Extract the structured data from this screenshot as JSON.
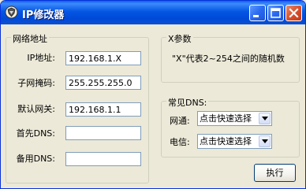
{
  "window": {
    "title": "IP修改器",
    "controls": [
      "minimize-icon",
      "maximize-icon",
      "close-icon"
    ],
    "titlebar_color": "#0054E3",
    "face_color": "#ECE9D8"
  },
  "network": {
    "group_title": "网络地址",
    "ip_label": "IP地址:",
    "ip_value": "192.168.1.X",
    "mask_label": "子网掩码:",
    "mask_value": "255.255.255.0",
    "gateway_label": "默认网关:",
    "gateway_value": "192.168.1.1",
    "dns1_label": "首先DNS:",
    "dns1_value": "",
    "dns2_label": "备用DNS:",
    "dns2_value": ""
  },
  "x_param": {
    "group_title": "X参数",
    "note": "\"X\"代表2~254之间的随机数"
  },
  "common_dns": {
    "group_title": "常见DNS:",
    "unicom_label": "网通:",
    "unicom_selected": "点击快速选择",
    "telecom_label": "电信:",
    "telecom_selected": "点击快速选择"
  },
  "actions": {
    "execute_label": "执行"
  }
}
